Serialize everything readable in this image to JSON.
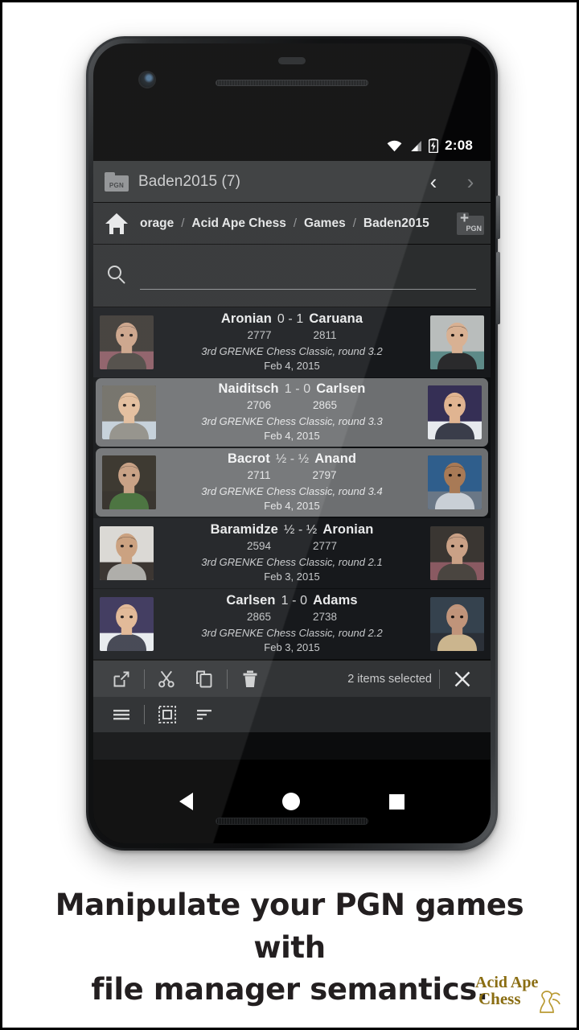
{
  "statusbar": {
    "time": "2:08",
    "icons": [
      "wifi-icon",
      "signal-icon",
      "battery-charging-icon"
    ]
  },
  "titlebar": {
    "folder_icon_label": "PGN",
    "title": "Baden2015 (7)",
    "prev_label": "‹",
    "next_label": "›"
  },
  "breadcrumb": {
    "home_icon": "home-icon",
    "crumbs": [
      "orage",
      "Acid Ape Chess",
      "Games",
      "Baden2015"
    ],
    "separator": "/",
    "add_pgn_label": "PGN",
    "add_plus": "+"
  },
  "search": {
    "icon": "search-icon",
    "value": "",
    "placeholder": ""
  },
  "games": [
    {
      "white": "Aronian",
      "score": "0 - 1",
      "black": "Caruana",
      "white_elo": "2777",
      "black_elo": "2811",
      "event": "3rd GRENKE Chess Classic, round 3.2",
      "date": "Feb 4, 2015",
      "selected": false
    },
    {
      "white": "Naiditsch",
      "score": "1 - 0",
      "black": "Carlsen",
      "white_elo": "2706",
      "black_elo": "2865",
      "event": "3rd GRENKE Chess Classic, round 3.3",
      "date": "Feb 4, 2015",
      "selected": true
    },
    {
      "white": "Bacrot",
      "score": "½ - ½",
      "black": "Anand",
      "white_elo": "2711",
      "black_elo": "2797",
      "event": "3rd GRENKE Chess Classic, round 3.4",
      "date": "Feb 4, 2015",
      "selected": true
    },
    {
      "white": "Baramidze",
      "score": "½ - ½",
      "black": "Aronian",
      "white_elo": "2594",
      "black_elo": "2777",
      "event": "3rd GRENKE Chess Classic, round 2.1",
      "date": "Feb 3, 2015",
      "selected": false
    },
    {
      "white": "Carlsen",
      "score": "1 - 0",
      "black": "Adams",
      "white_elo": "2865",
      "black_elo": "2738",
      "event": "3rd GRENKE Chess Classic, round 2.2",
      "date": "Feb 3, 2015",
      "selected": false
    }
  ],
  "actionbar": {
    "selection_text": "2 items selected",
    "tools": [
      "share-icon",
      "cut-icon",
      "copy-icon",
      "delete-icon"
    ],
    "close_label": "✕"
  },
  "toolbar2": {
    "tools": [
      "menu-icon",
      "select-all-icon",
      "sort-icon"
    ]
  },
  "navbar": {
    "back": "back-triangle-icon",
    "home": "home-circle-icon",
    "recents": "recents-square-icon"
  },
  "caption": {
    "line1": "Manipulate your PGN games with",
    "line2": "file manager semantics."
  },
  "logo": {
    "line1": "Acid Ape",
    "line2": "Chess",
    "color": "#9a7b18"
  },
  "colors": {
    "page_bg": "#ffffff",
    "app_bg": "#0d0f11",
    "titlebar_bg": "#333536",
    "breadcrumb_bg": "#2b2d2e",
    "row_bg": "#17191c",
    "row_selected_bg": "#6d6f71",
    "accent_text": "#e9eaeb"
  }
}
